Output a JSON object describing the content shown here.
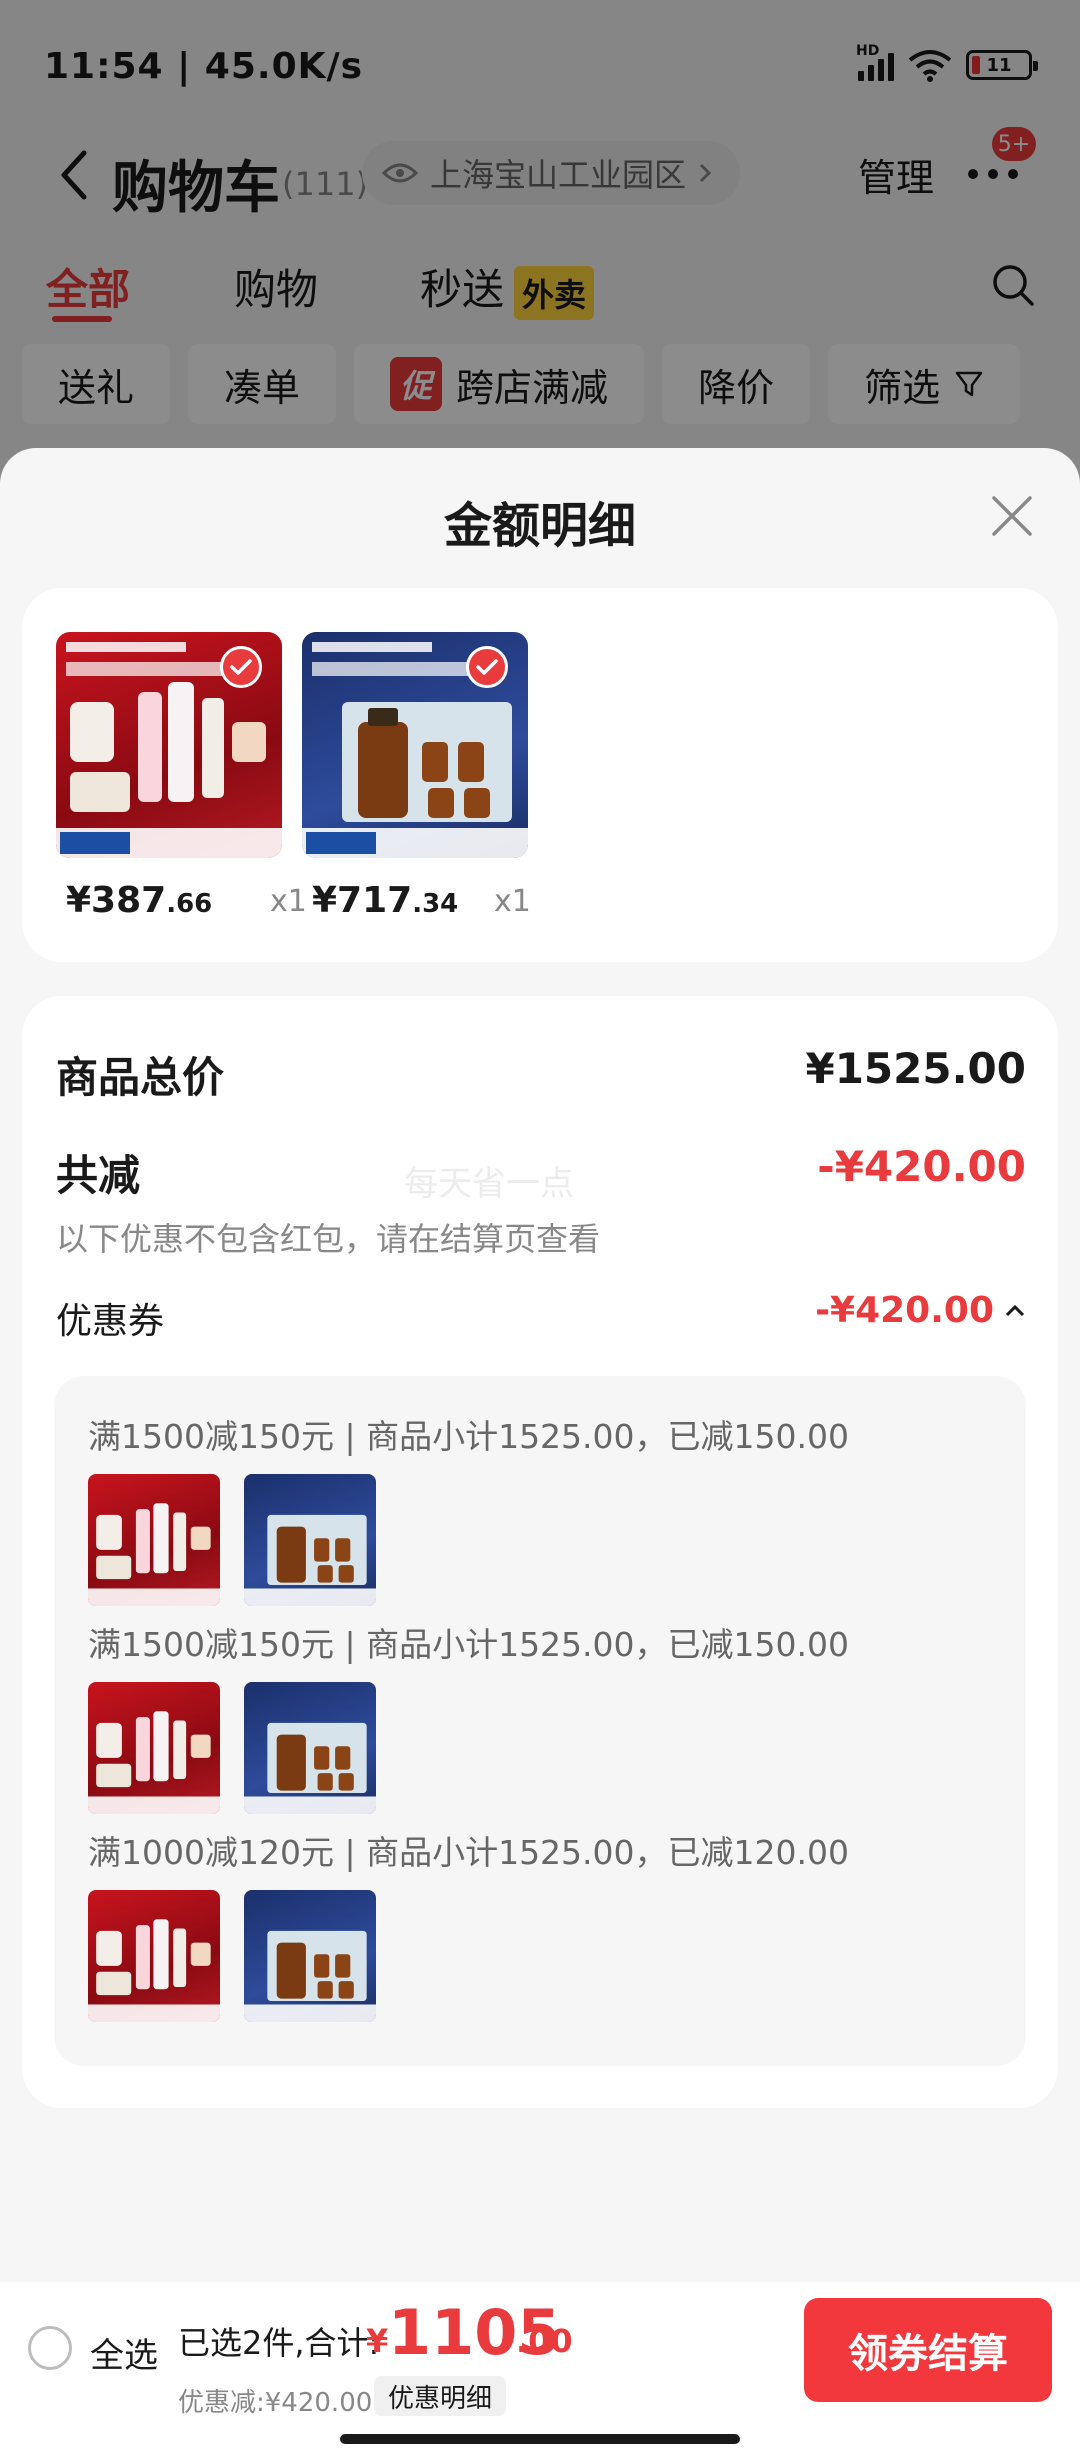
{
  "status_bar": {
    "time": "11:54 | 45.0K/s",
    "battery": "11",
    "signal_label": "HD"
  },
  "nav": {
    "title": "购物车",
    "count": "(111)",
    "address": "上海宝山工业园区",
    "manage": "管理",
    "badge": "5+"
  },
  "tabs": [
    {
      "label": "全部"
    },
    {
      "label": "购物"
    },
    {
      "label": "秒送"
    }
  ],
  "waimai_tag": "外卖",
  "filters": {
    "gift": "送礼",
    "bundle": "凑单",
    "promo_tag": "促",
    "cross_store": "跨店满减",
    "price_drop": "降价",
    "filter": "筛选"
  },
  "sheet": {
    "title": "金额明细",
    "products": [
      {
        "price_int": "¥387",
        "price_dec": ".66",
        "qty": "x1",
        "art": "red"
      },
      {
        "price_int": "¥717",
        "price_dec": ".34",
        "qty": "x1",
        "art": "blue"
      }
    ],
    "summary": {
      "total_label": "商品总价",
      "total_value": "¥1525.00",
      "reduce_label": "共减",
      "reduce_value": "-¥420.00",
      "note": "以下优惠不包含红包，请在结算页查看",
      "watermark": "每天省一点",
      "coupon_label": "优惠券",
      "coupon_value": "-¥420.00"
    },
    "coupons": [
      {
        "rule": "满1500减150元 | 商品小计1525.00，已减150.00"
      },
      {
        "rule": "满1500减150元 | 商品小计1525.00，已减150.00"
      },
      {
        "rule": "满1000减120元 | 商品小计1525.00，已减120.00"
      }
    ]
  },
  "bottom": {
    "select_all": "全选",
    "selected": "已选2件,合计:",
    "currency": "¥",
    "total_int": "1105",
    "total_dec": ".00",
    "discount": "优惠减:¥420.00",
    "detail": "优惠明细",
    "checkout": "领券结算"
  },
  "colors": {
    "accent": "#e93b3d",
    "waimai": "#ffd43b"
  }
}
